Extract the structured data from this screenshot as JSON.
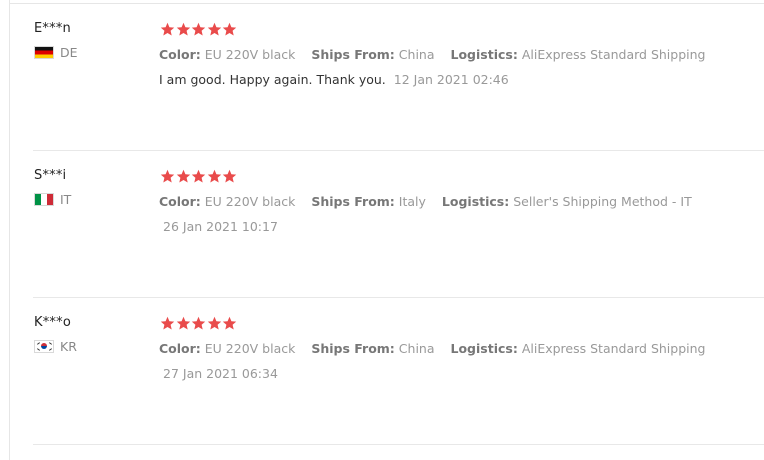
{
  "reviews": [
    {
      "user": "E***n",
      "country": "DE",
      "flag": "flag-de-icon",
      "rating": 5,
      "color_label": "Color:",
      "color_value": "EU 220V black",
      "ships_label": "Ships From:",
      "ships_value": "China",
      "logistics_label": "Logistics:",
      "logistics_value": "AliExpress Standard Shipping",
      "text": "I am good. Happy again. Thank you.",
      "date": "12 Jan 2021 02:46"
    },
    {
      "user": "S***i",
      "country": "IT",
      "flag": "flag-it-icon",
      "rating": 5,
      "color_label": "Color:",
      "color_value": "EU 220V black",
      "ships_label": "Ships From:",
      "ships_value": "Italy",
      "logistics_label": "Logistics:",
      "logistics_value": "Seller's Shipping Method - IT",
      "text": "",
      "date": "26 Jan 2021 10:17"
    },
    {
      "user": "K***o",
      "country": "KR",
      "flag": "flag-kr-icon",
      "rating": 5,
      "color_label": "Color:",
      "color_value": "EU 220V black",
      "ships_label": "Ships From:",
      "ships_value": "China",
      "logistics_label": "Logistics:",
      "logistics_value": "AliExpress Standard Shipping",
      "text": "",
      "date": "27 Jan 2021 06:34"
    }
  ],
  "colors": {
    "star": "#e94b4b",
    "divider": "#e8e8e8"
  }
}
